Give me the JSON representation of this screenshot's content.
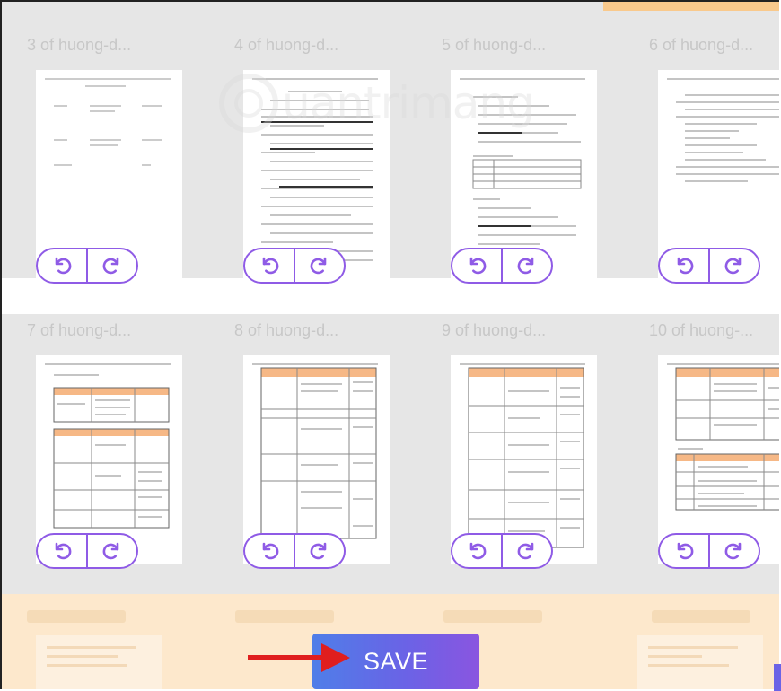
{
  "pages": [
    {
      "label": "3 of huong-d..."
    },
    {
      "label": "4 of huong-d..."
    },
    {
      "label": "5 of huong-d..."
    },
    {
      "label": "6 of huong-d..."
    },
    {
      "label": "7 of huong-d..."
    },
    {
      "label": "8 of huong-d..."
    },
    {
      "label": "9 of huong-d..."
    },
    {
      "label": "10 of huong-..."
    }
  ],
  "rotate_left_icon": "rotate-left-icon",
  "rotate_right_icon": "rotate-right-icon",
  "save_label": "SAVE",
  "watermark": "uantrimang",
  "colors": {
    "accent_purple": "#8f5be6",
    "grid_bg": "#e6e6e6",
    "bottom_band": "#fde8cc",
    "save_gradient_start": "#4f7ee8",
    "save_gradient_end": "#8a55e0",
    "arrow_red": "#e01e1e",
    "table_header_orange": "#f6b886"
  }
}
